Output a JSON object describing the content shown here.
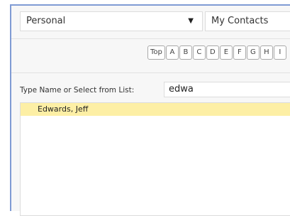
{
  "address_book": {
    "selected": "Personal",
    "icon": "chevron-down-icon"
  },
  "contacts_group": {
    "selected": "My Contacts"
  },
  "letter_filter": {
    "buttons": [
      "Top",
      "A",
      "B",
      "C",
      "D",
      "E",
      "F",
      "G",
      "H",
      "I"
    ]
  },
  "search": {
    "label": "Type Name or Select from List:",
    "value": "edwa"
  },
  "results": {
    "items": [
      "Edwards, Jeff"
    ],
    "highlight_color": "#fdefa5"
  },
  "colors": {
    "frame_border": "#7f9bd4",
    "panel_background": "#f7f7f7"
  }
}
